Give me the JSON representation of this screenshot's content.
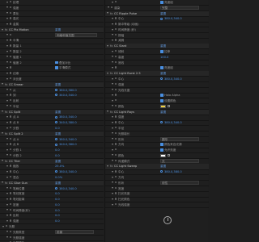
{
  "left_rows": [
    {
      "kind": "row",
      "indent": 1,
      "label": "纹理",
      "value": "",
      "reset": ""
    },
    {
      "kind": "row",
      "indent": 1,
      "label": "强度",
      "value": "",
      "reset": ""
    },
    {
      "kind": "row",
      "indent": 1,
      "label": "柔化",
      "value": "",
      "reset": ""
    },
    {
      "kind": "row",
      "indent": 1,
      "label": "高光",
      "value": "",
      "reset": ""
    },
    {
      "kind": "row",
      "indent": 1,
      "label": "金属",
      "value": "",
      "reset": ""
    },
    {
      "kind": "hdr",
      "label": "CC Pix Motion",
      "reset": "重置"
    },
    {
      "kind": "row",
      "indent": 1,
      "label": "",
      "value": "",
      "reset": "",
      "button": "网格和值范围"
    },
    {
      "kind": "row",
      "indent": 1,
      "label": "平滑",
      "value": "",
      "reset": ""
    },
    {
      "kind": "row",
      "indent": 1,
      "label": "数量 1",
      "value": "",
      "reset": ""
    },
    {
      "kind": "row",
      "indent": 1,
      "label": "数量 2",
      "value": "",
      "reset": ""
    },
    {
      "kind": "row",
      "indent": 1,
      "label": "值度 1",
      "value": "",
      "reset": ""
    },
    {
      "kind": "row",
      "indent": 1,
      "label": "值度 2",
      "value": "",
      "reset": "",
      "check": "叠加对比"
    },
    {
      "kind": "row",
      "indent": 1,
      "label": "",
      "value": "",
      "reset": "",
      "check": "平滑模式"
    },
    {
      "kind": "row",
      "indent": 1,
      "label": "边缘",
      "value": "",
      "reset": ""
    },
    {
      "kind": "row",
      "indent": 1,
      "label": "对比度",
      "value": "",
      "reset": ""
    },
    {
      "kind": "hdr",
      "label": "CC Smear",
      "reset": "重置"
    },
    {
      "kind": "row",
      "indent": 1,
      "label": "从",
      "value": "380.0,380.0",
      "reset": "",
      "target": true
    },
    {
      "kind": "row",
      "indent": 1,
      "label": "到",
      "value": "340.0,340.0",
      "reset": "",
      "target": true
    },
    {
      "kind": "row",
      "indent": 1,
      "label": "反射",
      "value": "",
      "reset": ""
    },
    {
      "kind": "row",
      "indent": 1,
      "label": "半径",
      "value": "",
      "reset": ""
    },
    {
      "kind": "hdr",
      "label": "CC Split",
      "reset": "重置"
    },
    {
      "kind": "row",
      "indent": 1,
      "label": "点 A",
      "value": "380.0,340.0",
      "reset": "",
      "target": true
    },
    {
      "kind": "row",
      "indent": 1,
      "label": "点 B",
      "value": "340.0,380.0",
      "reset": "",
      "target": true
    },
    {
      "kind": "row",
      "indent": 1,
      "label": "分割",
      "value": "0.0",
      "reset": ""
    },
    {
      "kind": "hdr",
      "label": "CC Split 2",
      "reset": "重置"
    },
    {
      "kind": "row",
      "indent": 1,
      "label": "点 A",
      "value": "380.0,340.0",
      "reset": "",
      "target": true
    },
    {
      "kind": "row",
      "indent": 1,
      "label": "点 B",
      "value": "340.0,380.0",
      "reset": "",
      "target": true
    },
    {
      "kind": "row",
      "indent": 1,
      "label": "分割 1",
      "value": "0.0",
      "reset": ""
    },
    {
      "kind": "row",
      "indent": 1,
      "label": "分割 2",
      "value": "0.0",
      "reset": ""
    },
    {
      "kind": "hdr",
      "label": "CC Tiler",
      "reset": "重置"
    },
    {
      "kind": "row",
      "indent": 1,
      "label": "缩放",
      "value": "25.0%",
      "reset": ""
    },
    {
      "kind": "row",
      "indent": 1,
      "label": "中心",
      "value": "380.0,340.0",
      "reset": "",
      "target": true
    },
    {
      "kind": "row",
      "indent": 1,
      "label": "混合",
      "value": "0.0%",
      "reset": ""
    },
    {
      "kind": "hdr",
      "label": "CC Glue Gun",
      "reset": "重置"
    },
    {
      "kind": "row",
      "indent": 1,
      "label": "笔刷位置",
      "value": "380.0,340.0",
      "reset": "",
      "target": true
    },
    {
      "kind": "row",
      "indent": 1,
      "label": "笔划宽度",
      "value": "0.0",
      "reset": ""
    },
    {
      "kind": "row",
      "indent": 1,
      "label": "笔划距离",
      "value": "0.0",
      "reset": ""
    },
    {
      "kind": "row",
      "indent": 1,
      "label": "密度",
      "value": "0.0",
      "reset": ""
    },
    {
      "kind": "row",
      "indent": 1,
      "label": "时间跨度(秒)",
      "value": "0.0",
      "reset": ""
    },
    {
      "kind": "row",
      "indent": 1,
      "label": "反射",
      "value": "0.0",
      "reset": ""
    },
    {
      "kind": "row",
      "indent": 1,
      "label": "强度",
      "value": "0.0",
      "reset": ""
    },
    {
      "kind": "row",
      "indent": 0,
      "label": "光照",
      "value": "",
      "reset": ""
    },
    {
      "kind": "row",
      "indent": 1,
      "label": "光照类型",
      "value": "",
      "reset": "",
      "dropdown": "前景"
    },
    {
      "kind": "row",
      "indent": 1,
      "label": "光照强度",
      "value": "",
      "reset": ""
    },
    {
      "kind": "row",
      "indent": 1,
      "label": "光照颜色",
      "value": "",
      "reset": ""
    }
  ],
  "right_rows": [
    {
      "kind": "row",
      "indent": 1,
      "label": "",
      "value": "",
      "reset": "",
      "check": "亮度组"
    },
    {
      "kind": "row",
      "indent": 0,
      "label": "渲染",
      "value": "",
      "reset": "",
      "dropdown": "完整"
    },
    {
      "kind": "hdr",
      "label": "CC Ripple Pulse",
      "reset": "重置"
    },
    {
      "kind": "row",
      "indent": 1,
      "label": "中心",
      "value": "380.0,340.0",
      "reset": "",
      "target": true
    },
    {
      "kind": "row",
      "indent": 1,
      "label": "脉冲等级 (动画)",
      "value": "",
      "reset": ""
    },
    {
      "kind": "row",
      "indent": 1,
      "label": "时间跨度 (秒)",
      "value": "",
      "reset": ""
    },
    {
      "kind": "row",
      "indent": 1,
      "label": "振幅",
      "value": "",
      "reset": ""
    },
    {
      "kind": "row",
      "indent": 1,
      "label": "减弱",
      "value": "",
      "reset": ""
    },
    {
      "kind": "hdr",
      "label": "CC Slant",
      "reset": "重置"
    },
    {
      "kind": "row",
      "indent": 1,
      "label": "倾斜",
      "value": "",
      "reset": "",
      "check": "拉伸"
    },
    {
      "kind": "row",
      "indent": 1,
      "label": "高度",
      "value": "100.0",
      "reset": ""
    },
    {
      "kind": "row",
      "indent": 1,
      "label": "底线",
      "value": "",
      "reset": ""
    },
    {
      "kind": "row",
      "indent": 1,
      "label": "",
      "value": "",
      "reset": "",
      "check": "亮度组"
    },
    {
      "kind": "hdr",
      "label": "CC Light Burst 2.5",
      "reset": "重置"
    },
    {
      "kind": "row",
      "indent": 1,
      "label": "中心",
      "value": "380.0,340.0",
      "reset": "",
      "target": true
    },
    {
      "kind": "row",
      "indent": 1,
      "label": "强度",
      "value": "",
      "reset": ""
    },
    {
      "kind": "row",
      "indent": 1,
      "label": "光线长度",
      "value": "",
      "reset": ""
    },
    {
      "kind": "row",
      "indent": 1,
      "label": "",
      "value": "",
      "reset": "",
      "check": "Halo Alpha"
    },
    {
      "kind": "row",
      "indent": 1,
      "label": "",
      "value": "",
      "reset": "",
      "check": "设置颜色"
    },
    {
      "kind": "row",
      "indent": 1,
      "label": "颜色",
      "value": "",
      "reset": "",
      "swatch": "#f0d040"
    },
    {
      "kind": "hdr",
      "label": "CC Light Rays",
      "reset": "重置"
    },
    {
      "kind": "row",
      "indent": 1,
      "label": "强度",
      "value": "",
      "reset": ""
    },
    {
      "kind": "row",
      "indent": 1,
      "label": "中心",
      "value": "380.0,340.0",
      "reset": "",
      "target": true
    },
    {
      "kind": "row",
      "indent": 1,
      "label": "半径",
      "value": "",
      "reset": ""
    },
    {
      "kind": "row",
      "indent": 1,
      "label": "光照增长",
      "value": "",
      "reset": ""
    },
    {
      "kind": "row",
      "indent": 1,
      "label": "形状",
      "value": "",
      "reset": "",
      "dropdown": "圆形"
    },
    {
      "kind": "row",
      "indent": 1,
      "label": "方向",
      "value": "",
      "reset": "",
      "check": "颜色来自光源"
    },
    {
      "kind": "row",
      "indent": 1,
      "label": "",
      "value": "",
      "reset": "",
      "check": "允许亮度"
    },
    {
      "kind": "row",
      "indent": 1,
      "label": "颜色",
      "value": "",
      "reset": "",
      "swatch": "#ffffff"
    },
    {
      "kind": "row",
      "indent": 1,
      "label": "传递模式",
      "value": "",
      "reset": "",
      "dropdown": "无"
    },
    {
      "kind": "hdr",
      "label": "CC Light Sweep",
      "reset": "重置"
    },
    {
      "kind": "row",
      "indent": 1,
      "label": "中心",
      "value": "380.0,380.0",
      "reset": "",
      "target": true
    },
    {
      "kind": "row",
      "indent": 1,
      "label": "方向",
      "value": "",
      "reset": ""
    },
    {
      "kind": "row",
      "indent": 1,
      "label": "形状",
      "value": "",
      "reset": "",
      "dropdown": "线性"
    },
    {
      "kind": "row",
      "indent": 1,
      "label": "宽度",
      "value": "",
      "reset": ""
    },
    {
      "kind": "row",
      "indent": 1,
      "label": "扫光亮度",
      "value": "",
      "reset": ""
    },
    {
      "kind": "row",
      "indent": 1,
      "label": "扫光颜色",
      "value": "",
      "reset": ""
    },
    {
      "kind": "row",
      "indent": 1,
      "label": "光线强度",
      "value": "",
      "reset": ""
    }
  ],
  "colors": {
    "accent": "#4a8fe0",
    "panel": "#1f1f1f",
    "header": "#262626"
  }
}
